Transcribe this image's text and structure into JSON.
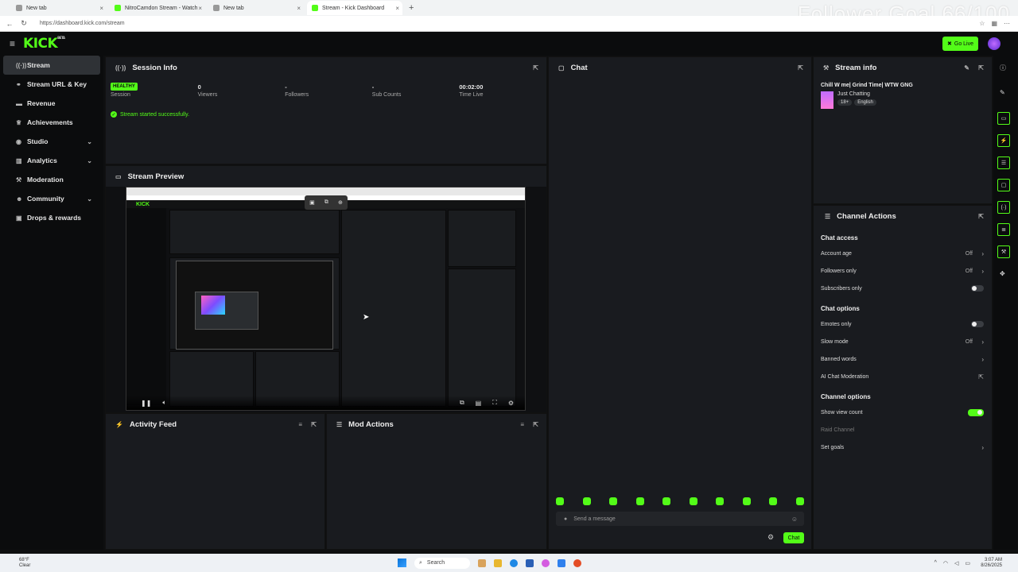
{
  "browser": {
    "tabs": [
      {
        "label": "New tab"
      },
      {
        "label": "NitroCamdon Stream - Watch"
      },
      {
        "label": "New tab"
      },
      {
        "label": "Stream - Kick Dashboard"
      }
    ],
    "url": "https://dashboard.kick.com/stream",
    "overlay_text": "Follower Goal 66/100"
  },
  "topbar": {
    "logo": "KICK",
    "logo_badge": "BETA",
    "go_live_label": "Go Live"
  },
  "sidebar": {
    "items": [
      {
        "label": "Stream",
        "icon": "broadcast-icon"
      },
      {
        "label": "Stream URL & Key",
        "icon": "link-icon"
      },
      {
        "label": "Revenue",
        "icon": "money-icon"
      },
      {
        "label": "Achievements",
        "icon": "trophy-icon"
      },
      {
        "label": "Studio",
        "icon": "palette-icon"
      },
      {
        "label": "Analytics",
        "icon": "chart-icon"
      },
      {
        "label": "Moderation",
        "icon": "hammer-icon"
      },
      {
        "label": "Community",
        "icon": "users-icon"
      },
      {
        "label": "Drops & rewards",
        "icon": "gift-icon"
      }
    ]
  },
  "session": {
    "title": "Session Info",
    "status_badge": "HEALTHY",
    "stats": [
      {
        "value": "",
        "label": "Session"
      },
      {
        "value": "0",
        "label": "Viewers"
      },
      {
        "value": "-",
        "label": "Followers"
      },
      {
        "value": "-",
        "label": "Sub Counts"
      },
      {
        "value": "00:02:00",
        "label": "Time Live"
      }
    ],
    "message": "Stream started successfully."
  },
  "preview": {
    "title": "Stream Preview"
  },
  "activity": {
    "title": "Activity Feed"
  },
  "mod": {
    "title": "Mod Actions"
  },
  "chat": {
    "title": "Chat",
    "placeholder": "Send a message",
    "send_label": "Chat"
  },
  "stream_info": {
    "title": "Stream info",
    "stream_title": "Chill W me| Grind Time| WTW GNG",
    "category": "Just Chatting",
    "tags": [
      "18+",
      "English"
    ]
  },
  "channel_actions": {
    "title": "Channel Actions",
    "sections": [
      {
        "heading": "Chat access",
        "rows": [
          {
            "label": "Account age",
            "value": "Off",
            "kind": "chevron"
          },
          {
            "label": "Followers only",
            "value": "Off",
            "kind": "chevron"
          },
          {
            "label": "Subscribers only",
            "value": "",
            "kind": "toggle-off"
          }
        ]
      },
      {
        "heading": "Chat options",
        "rows": [
          {
            "label": "Emotes only",
            "value": "",
            "kind": "toggle-off"
          },
          {
            "label": "Slow mode",
            "value": "Off",
            "kind": "chevron"
          },
          {
            "label": "Banned words",
            "value": "",
            "kind": "chevron"
          },
          {
            "label": "AI Chat Moderation",
            "value": "",
            "kind": "external"
          }
        ]
      },
      {
        "heading": "Channel options",
        "rows": [
          {
            "label": "Show view count",
            "value": "",
            "kind": "toggle-on"
          },
          {
            "label": "Raid Channel",
            "value": "",
            "kind": "disabled"
          },
          {
            "label": "Set goals",
            "value": "",
            "kind": "chevron"
          }
        ]
      }
    ]
  },
  "taskbar": {
    "temp": "68°F",
    "weather": "Clear",
    "search": "Search",
    "time": "3:07 AM",
    "date": "8/26/2025"
  },
  "colors": {
    "accent": "#53fc18",
    "panel": "#191b1f",
    "background": "#0e0f10"
  }
}
